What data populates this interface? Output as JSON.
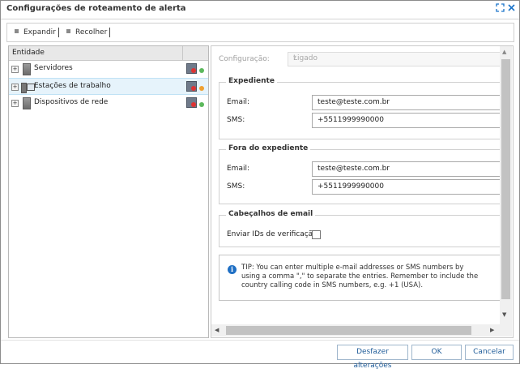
{
  "window": {
    "title": "Configurações de roteamento de alerta"
  },
  "toolbar": {
    "expand_label": "Expandir",
    "collapse_label": "Recolher"
  },
  "tree": {
    "column_header": "Entidade",
    "items": [
      {
        "label": "Servidores",
        "icon": "server-icon",
        "status_color": "#5cb85c"
      },
      {
        "label": "Estações de trabalho",
        "icon": "workstation-icon",
        "status_color": "#f0a030"
      },
      {
        "label": "Dispositivos de rede",
        "icon": "network-device-icon",
        "status_color": "#5cb85c"
      }
    ]
  },
  "config": {
    "label": "Configuração:",
    "value": "Ligado"
  },
  "business_hours": {
    "title": "Expediente",
    "email_label": "Email:",
    "email_value": "teste@teste.com.br",
    "sms_label": "SMS:",
    "sms_value": "+5511999990000"
  },
  "after_hours": {
    "title": "Fora do expediente",
    "email_label": "Email:",
    "email_value": "teste@teste.com.br",
    "sms_label": "SMS:",
    "sms_value": "+5511999990000"
  },
  "email_headers": {
    "title": "Cabeçalhos de email",
    "send_ids_label": "Enviar IDs de verificação:",
    "send_ids_checked": false
  },
  "tip": {
    "text": "TIP: You can enter multiple e-mail addresses or SMS numbers by using a comma \",\" to separate the entries. Remember to include the country calling code in SMS numbers, e.g. +1 (USA)."
  },
  "buttons": {
    "discard": "Desfazer alterações",
    "ok": "OK",
    "cancel": "Cancelar"
  },
  "colors": {
    "accent": "#1a73c9",
    "selection": "#e6f3fb"
  }
}
